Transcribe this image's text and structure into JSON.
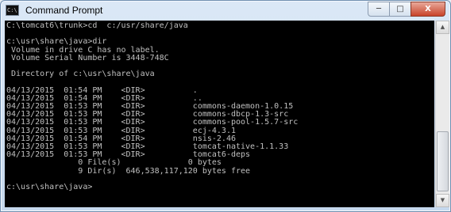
{
  "window": {
    "title": "Command Prompt"
  },
  "caption": {
    "minimize": "─",
    "maximize": "□",
    "close": "X"
  },
  "icons": {
    "app": "cmd-icon",
    "scroll_up": "scroll-up-arrow-icon",
    "scroll_down": "scroll-down-arrow-icon"
  },
  "console": {
    "lines": [
      "C:\\tomcat6\\trunk>cd  c:/usr/share/java",
      "",
      "c:\\usr\\share\\java>dir",
      " Volume in drive C has no label.",
      " Volume Serial Number is 3448-748C",
      "",
      " Directory of c:\\usr\\share\\java",
      "",
      "04/13/2015  01:54 PM    <DIR>          .",
      "04/13/2015  01:54 PM    <DIR>          ..",
      "04/13/2015  01:53 PM    <DIR>          commons-daemon-1.0.15",
      "04/13/2015  01:53 PM    <DIR>          commons-dbcp-1.3-src",
      "04/13/2015  01:53 PM    <DIR>          commons-pool-1.5.7-src",
      "04/13/2015  01:53 PM    <DIR>          ecj-4.3.1",
      "04/13/2015  01:54 PM    <DIR>          nsis-2.46",
      "04/13/2015  01:53 PM    <DIR>          tomcat-native-1.1.33",
      "04/13/2015  01:53 PM    <DIR>          tomcat6-deps",
      "               0 File(s)              0 bytes",
      "               9 Dir(s)  646,538,117,120 bytes free",
      "",
      "c:\\usr\\share\\java>"
    ]
  }
}
